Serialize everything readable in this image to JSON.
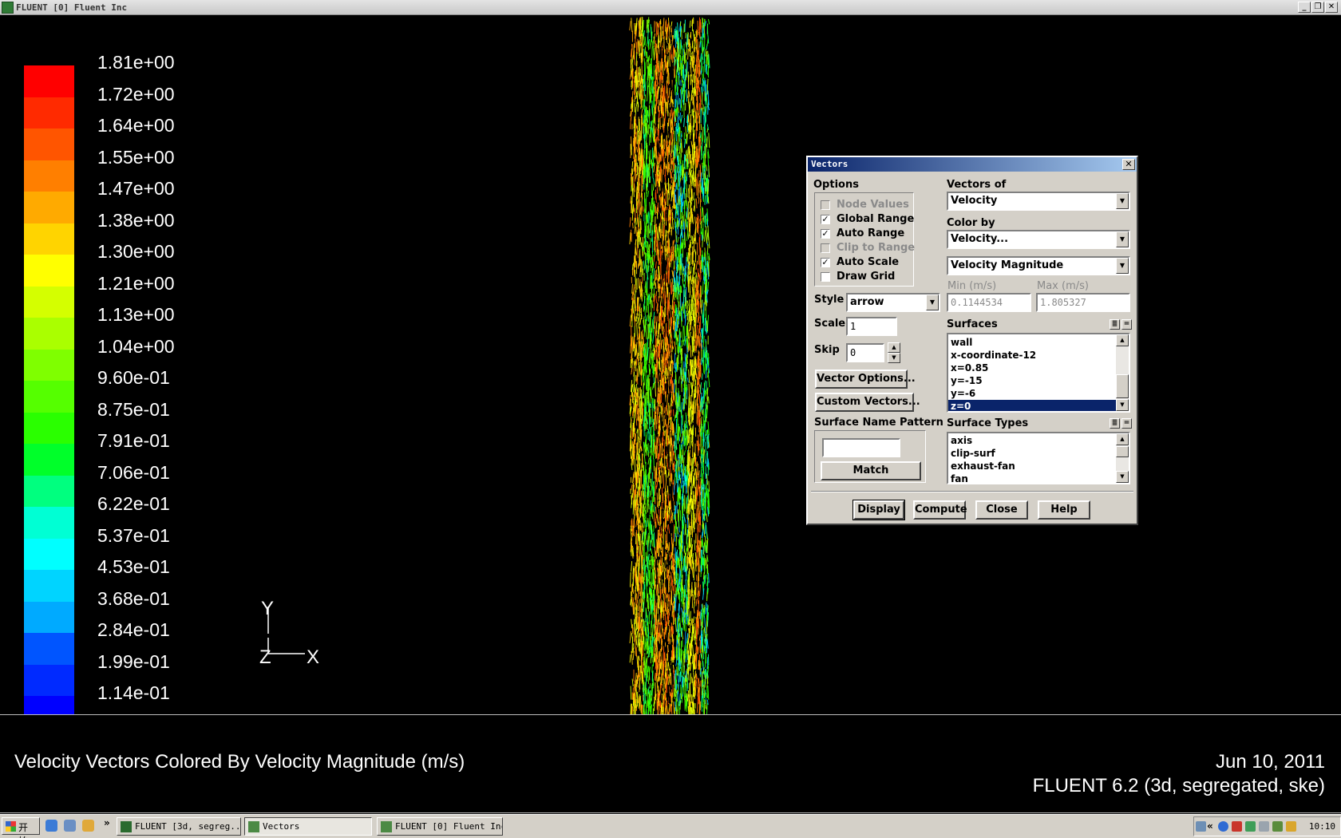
{
  "window": {
    "title": "FLUENT [0] Fluent Inc",
    "controls": [
      "_",
      "❐",
      "✕"
    ]
  },
  "graphics": {
    "colormap": [
      {
        "label": "1.81e+00",
        "color": "#ff0000"
      },
      {
        "label": "1.72e+00",
        "color": "#ff2a00"
      },
      {
        "label": "1.64e+00",
        "color": "#ff5500"
      },
      {
        "label": "1.55e+00",
        "color": "#ff7f00"
      },
      {
        "label": "1.47e+00",
        "color": "#ffaa00"
      },
      {
        "label": "1.38e+00",
        "color": "#ffd400"
      },
      {
        "label": "1.30e+00",
        "color": "#ffff00"
      },
      {
        "label": "1.21e+00",
        "color": "#d4ff00"
      },
      {
        "label": "1.13e+00",
        "color": "#aaff00"
      },
      {
        "label": "1.04e+00",
        "color": "#7fff00"
      },
      {
        "label": "9.60e-01",
        "color": "#55ff00"
      },
      {
        "label": "8.75e-01",
        "color": "#2aff00"
      },
      {
        "label": "7.91e-01",
        "color": "#00ff2a"
      },
      {
        "label": "7.06e-01",
        "color": "#00ff7f"
      },
      {
        "label": "6.22e-01",
        "color": "#00ffd4"
      },
      {
        "label": "5.37e-01",
        "color": "#00ffff"
      },
      {
        "label": "4.53e-01",
        "color": "#00d4ff"
      },
      {
        "label": "3.68e-01",
        "color": "#00aaff"
      },
      {
        "label": "2.84e-01",
        "color": "#0055ff"
      },
      {
        "label": "1.99e-01",
        "color": "#002aff"
      },
      {
        "label": "1.14e-01",
        "color": "#0000ff"
      }
    ],
    "axes": {
      "y": "Y",
      "z": "Z",
      "x": "X"
    }
  },
  "caption": {
    "title": "Velocity Vectors Colored By Velocity Magnitude (m/s)",
    "date": "Jun 10, 2011",
    "version": "FLUENT 6.2 (3d, segregated, ske)"
  },
  "dialog": {
    "title": "Vectors",
    "options_label": "Options",
    "options": [
      {
        "label": "Node Values",
        "checked": false,
        "enabled": false
      },
      {
        "label": "Global Range",
        "checked": true,
        "enabled": true
      },
      {
        "label": "Auto Range",
        "checked": true,
        "enabled": true
      },
      {
        "label": "Clip to Range",
        "checked": false,
        "enabled": false
      },
      {
        "label": "Auto Scale",
        "checked": true,
        "enabled": true
      },
      {
        "label": "Draw Grid",
        "checked": false,
        "enabled": true
      }
    ],
    "vectors_of_label": "Vectors of",
    "vectors_of_value": "Velocity",
    "color_by_label": "Color by",
    "color_by_value": "Velocity...",
    "color_by_sub_value": "Velocity Magnitude",
    "min_label": "Min (m/s)",
    "max_label": "Max (m/s)",
    "min_value": "0.1144534",
    "max_value": "1.805327",
    "style_label": "Style",
    "style_value": "arrow",
    "scale_label": "Scale",
    "scale_value": "1",
    "skip_label": "Skip",
    "skip_value": "0",
    "vector_options_btn": "Vector Options...",
    "custom_vectors_btn": "Custom Vectors...",
    "surface_name_pattern_label": "Surface Name Pattern",
    "surface_name_pattern_value": "",
    "match_btn": "Match",
    "surfaces_label": "Surfaces",
    "surfaces": [
      {
        "name": "wall",
        "selected": false
      },
      {
        "name": "x-coordinate-12",
        "selected": false
      },
      {
        "name": "x=0.85",
        "selected": false
      },
      {
        "name": "y=-15",
        "selected": false
      },
      {
        "name": "y=-6",
        "selected": false
      },
      {
        "name": "z=0",
        "selected": true
      }
    ],
    "surface_types_label": "Surface Types",
    "surface_types": [
      "axis",
      "clip-surf",
      "exhaust-fan",
      "fan"
    ],
    "buttons": {
      "display": "Display",
      "compute": "Compute",
      "close": "Close",
      "help": "Help"
    }
  },
  "taskbar": {
    "start_label": "开始",
    "tasks": [
      {
        "label": "FLUENT  [3d, segreg...",
        "active": false
      },
      {
        "label": "Vectors",
        "active": true
      },
      {
        "label": "FLUENT [0] Fluent Inc",
        "active": false
      }
    ],
    "overflow": "»",
    "tray_overflow": "«",
    "clock": "10:10"
  }
}
